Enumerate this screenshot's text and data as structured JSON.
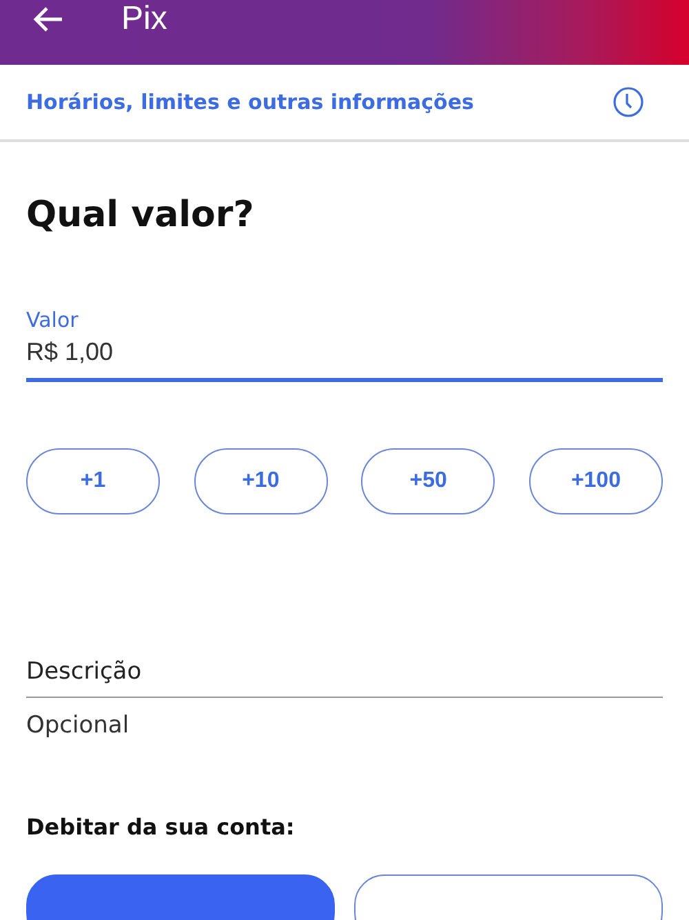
{
  "app_bar": {
    "title": "Pix"
  },
  "info_link": {
    "label": "Horários, limites e outras informações"
  },
  "heading": "Qual valor?",
  "amount_field": {
    "label": "Valor",
    "value": "R$ 1,00"
  },
  "quick_add": [
    "+1",
    "+10",
    "+50",
    "+100"
  ],
  "description_field": {
    "label": "Descrição",
    "placeholder": "Opcional"
  },
  "debit_section": {
    "title": "Debitar da sua conta:",
    "accounts": [
      {
        "selected": true
      },
      {
        "selected": false
      }
    ]
  }
}
